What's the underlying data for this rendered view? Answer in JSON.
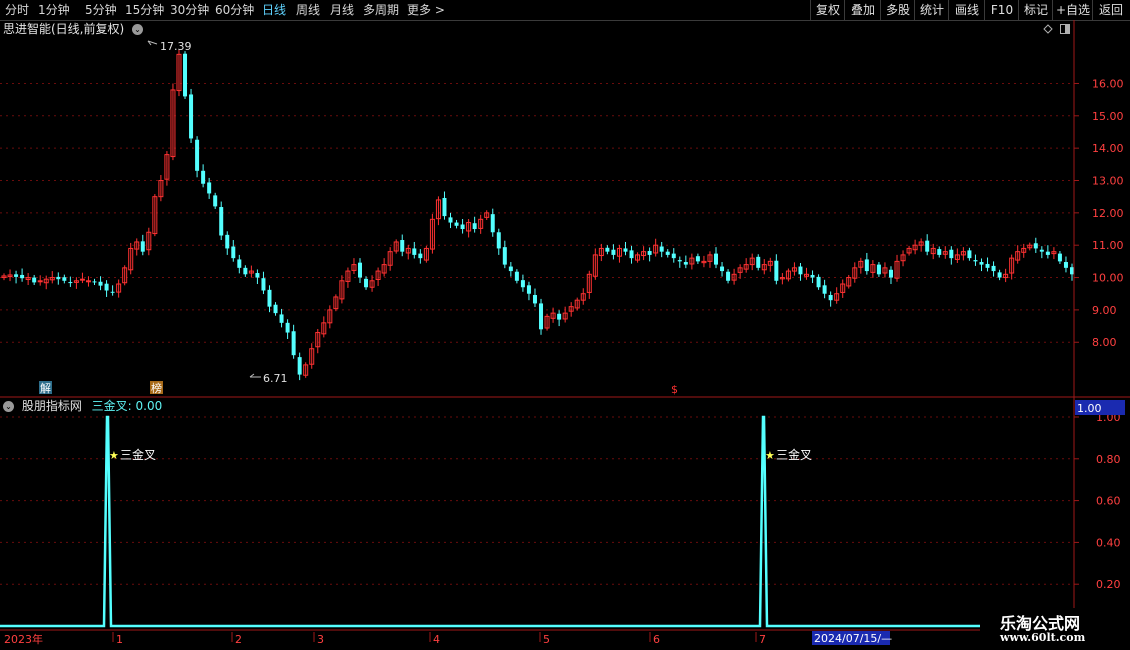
{
  "toolbar": {
    "periods": [
      "分时",
      "1分钟",
      "5分钟",
      "15分钟",
      "30分钟",
      "60分钟",
      "日线",
      "周线",
      "月线",
      "多周期",
      "更多 >"
    ],
    "active_period": "日线",
    "actions": [
      "复权",
      "叠加",
      "多股",
      "统计",
      "画线",
      "F10",
      "标记",
      "+自选",
      "返回"
    ]
  },
  "main_chart": {
    "title": "思进智能(日线,前复权)",
    "high_label": "17.39",
    "low_label": "6.71",
    "y_ticks": [
      "16.00",
      "15.00",
      "14.00",
      "13.00",
      "12.00",
      "11.00",
      "10.00",
      "9.00",
      "8.00"
    ],
    "markers": [
      "解",
      "榜",
      "$"
    ]
  },
  "indicator": {
    "name": "股朋指标网",
    "formula": "三金叉: 0.00",
    "signal_label": "三金叉",
    "current_value": "1.00",
    "y_ticks": [
      "1.00",
      "0.80",
      "0.60",
      "0.40",
      "0.20"
    ]
  },
  "x_axis": {
    "labels": [
      "2023年",
      "1",
      "2",
      "3",
      "4",
      "5",
      "6",
      "7"
    ],
    "cursor_date": "2024/07/15/—"
  },
  "watermark": {
    "line1": "乐淘公式网",
    "line2": "www.60lt.com"
  },
  "colors": {
    "up": "#ff3232",
    "down": "#54ffff",
    "grid": "#7a1010",
    "active": "#5fd3ff",
    "signal": "#ffff55"
  },
  "chart_data": {
    "type": "candlestick",
    "title": "思进智能(日线,前复权)",
    "ylim": [
      6.4,
      17.9
    ],
    "price_high": 17.39,
    "price_low": 6.71,
    "closes": [
      10.05,
      10.08,
      10.02,
      9.98,
      10.0,
      9.85,
      9.9,
      9.95,
      10.0,
      9.95,
      9.9,
      9.85,
      9.9,
      9.95,
      9.9,
      9.85,
      9.75,
      9.6,
      9.55,
      9.8,
      10.3,
      10.9,
      11.1,
      10.8,
      11.4,
      12.5,
      13.0,
      13.8,
      15.8,
      16.9,
      15.6,
      14.3,
      13.3,
      12.9,
      12.6,
      12.2,
      11.3,
      10.9,
      10.6,
      10.3,
      10.1,
      10.2,
      10.0,
      9.6,
      9.1,
      8.9,
      8.6,
      8.3,
      7.6,
      7.0,
      7.3,
      7.8,
      8.3,
      8.6,
      9.0,
      9.4,
      9.9,
      10.2,
      10.4,
      10.0,
      9.7,
      9.9,
      10.2,
      10.4,
      10.8,
      11.1,
      10.8,
      10.9,
      10.7,
      10.6,
      10.9,
      11.8,
      12.4,
      11.9,
      11.7,
      11.6,
      11.5,
      11.7,
      11.5,
      11.8,
      12.0,
      11.4,
      10.9,
      10.4,
      10.2,
      9.9,
      9.7,
      9.5,
      9.2,
      8.4,
      8.8,
      8.9,
      8.7,
      8.9,
      9.1,
      9.3,
      9.5,
      10.1,
      10.7,
      10.9,
      10.8,
      10.7,
      10.9,
      10.8,
      10.6,
      10.7,
      10.8,
      10.7,
      11.0,
      10.8,
      10.7,
      10.6,
      10.5,
      10.4,
      10.6,
      10.5,
      10.5,
      10.7,
      10.4,
      10.2,
      9.9,
      10.1,
      10.3,
      10.4,
      10.6,
      10.3,
      10.4,
      10.5,
      9.9,
      10.0,
      10.2,
      10.3,
      10.1,
      10.1,
      10.0,
      9.7,
      9.5,
      9.3,
      9.5,
      9.8,
      10.0,
      10.3,
      10.5,
      10.2,
      10.4,
      10.1,
      10.3,
      10.0,
      10.5,
      10.7,
      10.9,
      11.0,
      11.1,
      10.8,
      10.9,
      10.7,
      10.8,
      10.6,
      10.7,
      10.8,
      10.6,
      10.5,
      10.4,
      10.3,
      10.2,
      10.0,
      10.1,
      10.6,
      10.8,
      10.9,
      11.0,
      10.9,
      10.8,
      10.7,
      10.8,
      10.5,
      10.3,
      10.1
    ]
  },
  "indicator_data": {
    "type": "line",
    "ylim": [
      0,
      1.0
    ],
    "signals": [
      {
        "label": "三金叉",
        "value": 1.0,
        "date_label": "1"
      },
      {
        "label": "三金叉",
        "value": 1.0,
        "date_label": "7"
      }
    ]
  }
}
